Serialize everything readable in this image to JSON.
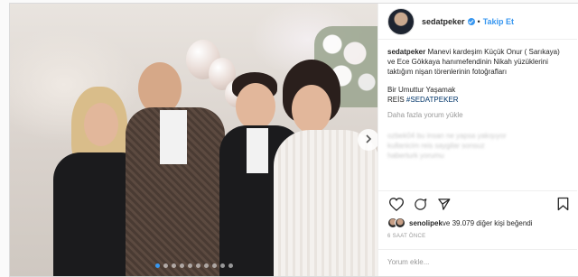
{
  "post": {
    "username": "sedatpeker",
    "separator": "•",
    "follow_label": "Takip Et",
    "caption_user": "sedatpeker",
    "caption_text": "Manevi kardeşim Küçük Onur ( Sarıkaya) ve Ece Gökkaya hanımefendinin Nikah yüzüklerini taktığım nişan törenlerinin fotoğrafları",
    "caption_line2": "Bir Umuttur Yaşamak",
    "caption_reis": "REİS ",
    "hashtag": "#SEDATPEKER",
    "load_more": "Daha fazla yorum yükle",
    "blurred_comments": [
      "ozbek04 bu insan ne yapsa yakışıyor",
      "kullanicim reis saygilar sonsuz",
      "haberturk yorumu"
    ],
    "likes_user": "senolipek",
    "likes_rest": " ve 39.079 diğer kişi beğendi",
    "time": "6 SAAT ÖNCE",
    "comment_placeholder": "Yorum ekle...",
    "carousel": {
      "count": 10,
      "active_index": 0
    }
  },
  "colors": {
    "accent": "#3897f0",
    "hashtag": "#003569",
    "muted": "#999999"
  },
  "icons": [
    "verified-badge-icon",
    "heart-icon",
    "comment-icon",
    "share-icon",
    "bookmark-icon",
    "chevron-right-icon"
  ]
}
